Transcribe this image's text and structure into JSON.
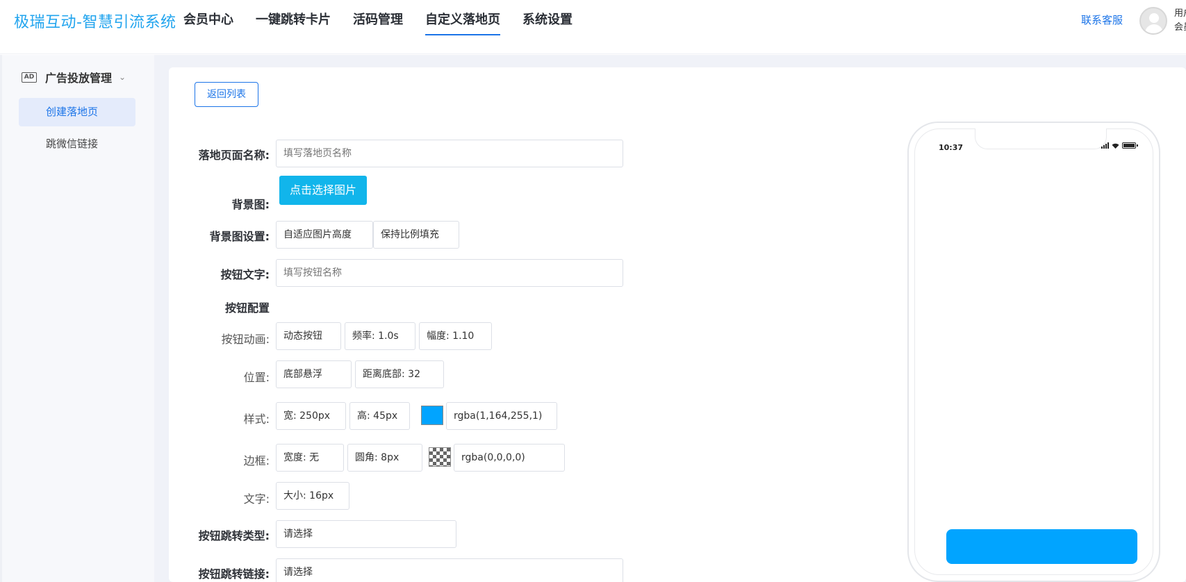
{
  "app": {
    "logo": "极瑞互动-智慧引流系统"
  },
  "nav": {
    "items": [
      {
        "label": "会员中心"
      },
      {
        "label": "一键跳转卡片"
      },
      {
        "label": "活码管理"
      },
      {
        "label": "自定义落地页",
        "active": true
      },
      {
        "label": "系统设置"
      }
    ],
    "contact": "联系客服",
    "user_line1": "用户",
    "user_line2": "会员"
  },
  "sidebar": {
    "group_label": "广告投放管理",
    "group_icon": "AD",
    "items": [
      {
        "label": "创建落地页",
        "active": true
      },
      {
        "label": "跳微信链接"
      }
    ]
  },
  "form": {
    "back_label": "返回列表",
    "page_name_label": "落地页面名称:",
    "page_name_placeholder": "填写落地页名称",
    "bg_label": "背景图:",
    "bg_button": "点击选择图片",
    "bg_settings_label": "背景图设置:",
    "bg_setting_1": "自适应图片高度",
    "bg_setting_2": "保持比例填充",
    "button_text_label": "按钮文字:",
    "button_text_placeholder": "填写按钮名称",
    "button_config_label": "按钮配置",
    "anim_label": "按钮动画:",
    "anim_type": "动态按钮",
    "anim_freq": "频率: 1.0s",
    "anim_amp": "幅度: 1.10",
    "position_label": "位置:",
    "position_type": "底部悬浮",
    "position_distance": "距离底部: 32",
    "style_label": "样式:",
    "style_width": "宽: 250px",
    "style_height": "高: 45px",
    "style_color": "rgba(1,164,255,1)",
    "style_swatch": "#01a4ff",
    "border_label": "边框:",
    "border_width": "宽度: 无",
    "border_radius": "圆角: 8px",
    "border_color": "rgba(0,0,0,0)",
    "text_label": "文字:",
    "text_size": "大小: 16px",
    "jump_type_label": "按钮跳转类型:",
    "jump_type_value": "请选择",
    "jump_link_label": "按钮跳转链接:",
    "jump_link_value": "请选择"
  },
  "preview": {
    "time": "10:37",
    "button_color": "#01a4ff"
  }
}
